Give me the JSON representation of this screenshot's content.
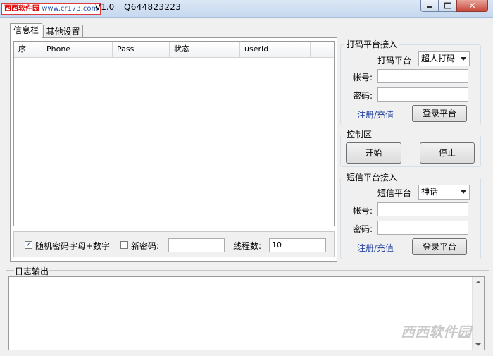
{
  "window": {
    "watermark_site": "西西软件园",
    "watermark_url": "www.cr173.com",
    "version": "V1.0",
    "qq": "Q644823223"
  },
  "tabs": [
    {
      "label": "信息栏",
      "active": true
    },
    {
      "label": "其他设置",
      "active": false
    }
  ],
  "list": {
    "columns": [
      "序",
      "Phone",
      "Pass",
      "状态",
      "userId"
    ]
  },
  "options": {
    "random_pwd_label": "随机密码字母+数字",
    "random_pwd_checked": true,
    "new_pwd_label": "新密码:",
    "new_pwd_checked": false,
    "new_pwd_value": "",
    "threads_label": "线程数:",
    "threads_value": "10"
  },
  "captcha_group": {
    "title": "打码平台接入",
    "platform_label": "打码平台",
    "platform_value": "超人打码",
    "account_label": "帐号:",
    "account_value": "",
    "password_label": "密码:",
    "password_value": "",
    "register_link": "注册/充值",
    "login_button": "登录平台"
  },
  "control_group": {
    "title": "控制区",
    "start_button": "开始",
    "stop_button": "停止"
  },
  "sms_group": {
    "title": "短信平台接入",
    "platform_label": "短信平台",
    "platform_value": "神话",
    "account_label": "帐号:",
    "account_value": "",
    "password_label": "密码:",
    "password_value": "",
    "register_link": "注册/充值",
    "login_button": "登录平台"
  },
  "log": {
    "title": "日志输出",
    "content": ""
  },
  "watermark_bottom": "西西软件园"
}
